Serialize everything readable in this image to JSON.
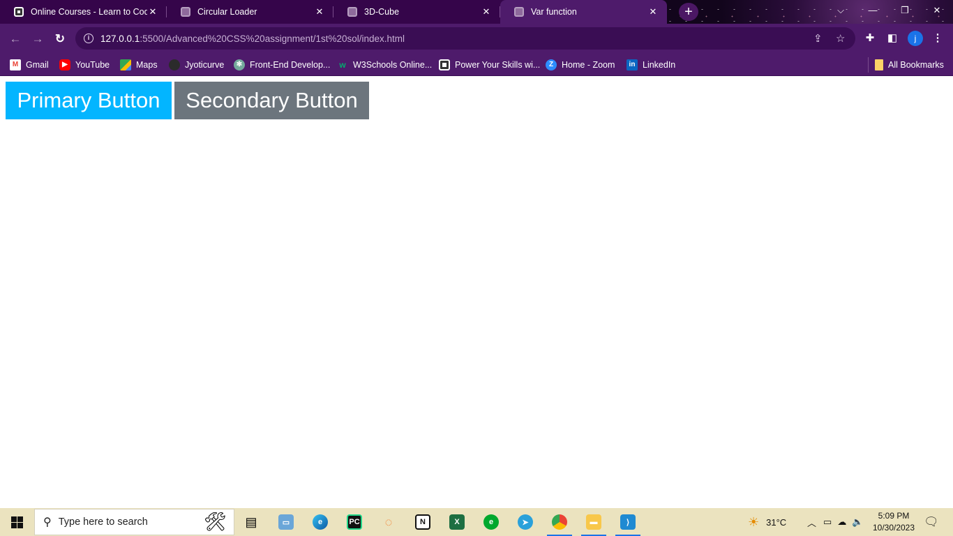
{
  "browser": {
    "tabs": [
      {
        "title": "Online Courses - Learn to Code a",
        "favicon": "codeland-icon"
      },
      {
        "title": "Circular Loader",
        "favicon": "globe-icon"
      },
      {
        "title": "3D-Cube",
        "favicon": "globe-icon"
      },
      {
        "title": "Var function",
        "favicon": "globe-icon"
      }
    ],
    "tab_close_glyph": "✕",
    "new_tab_glyph": "+",
    "window_controls": {
      "tab_search": "⌵",
      "minimize": "—",
      "restore": "❐",
      "close": "✕"
    },
    "toolbar": {
      "back_glyph": "←",
      "forward_glyph": "→",
      "reload_glyph": "↻",
      "url_host": "127.0.0.1",
      "url_rest": ":5500/Advanced%20CSS%20assignment/1st%20sol/index.html",
      "profile_initial": "j"
    },
    "bookmarks": [
      {
        "label": "Gmail",
        "icon": "gmail-icon"
      },
      {
        "label": "YouTube",
        "icon": "youtube-icon"
      },
      {
        "label": "Maps",
        "icon": "maps-icon"
      },
      {
        "label": "Jyoticurve",
        "icon": "github-icon"
      },
      {
        "label": "Front-End Develop...",
        "icon": "openai-icon"
      },
      {
        "label": "W3Schools Online...",
        "icon": "w3schools-icon"
      },
      {
        "label": "Power Your Skills wi...",
        "icon": "codeland-icon"
      },
      {
        "label": "Home - Zoom",
        "icon": "zoom-icon"
      },
      {
        "label": "LinkedIn",
        "icon": "linkedin-icon"
      }
    ],
    "all_bookmarks": "All Bookmarks"
  },
  "page": {
    "primary_button": "Primary Button",
    "secondary_button": "Secondary Button",
    "colors": {
      "primary": "#03b5ff",
      "secondary": "#6c757d"
    }
  },
  "taskbar": {
    "search_placeholder": "Type here to search",
    "apps": [
      "task-view-icon",
      "laptop-icon",
      "edge-icon",
      "pycharm-icon",
      "jupyter-icon",
      "notion-icon",
      "excel-icon",
      "evernote-icon",
      "telegram-icon",
      "chrome-icon",
      "file-explorer-icon",
      "vscode-icon"
    ],
    "weather": "31°C",
    "time": "5:09 PM",
    "date": "10/30/2023"
  }
}
